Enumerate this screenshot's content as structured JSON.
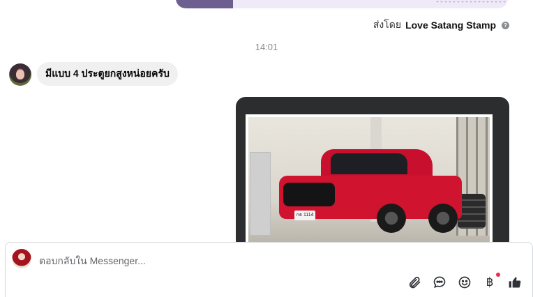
{
  "header_sticker": {
    "sent_by_prefix": "ส่งโดย",
    "sticker_name": "Love Satang Stamp"
  },
  "timestamp": "14:01",
  "incoming_message": {
    "text": "มีแบบ 4 ประตูยกสูงหน่อยครับ"
  },
  "image_plate_text": "กธ 1114",
  "composer": {
    "placeholder": "ตอบกลับใน Messenger..."
  },
  "toolbar": {
    "icons": [
      "paperclip-icon",
      "chat-bubble-icon",
      "emoji-icon",
      "baht-icon",
      "thumbs-up-icon"
    ],
    "baht_symbol": "฿"
  },
  "colors": {
    "notification_dot": "#f0284a",
    "bubble_bg": "#f0f0f0",
    "card_bg": "#2b2d2e"
  }
}
